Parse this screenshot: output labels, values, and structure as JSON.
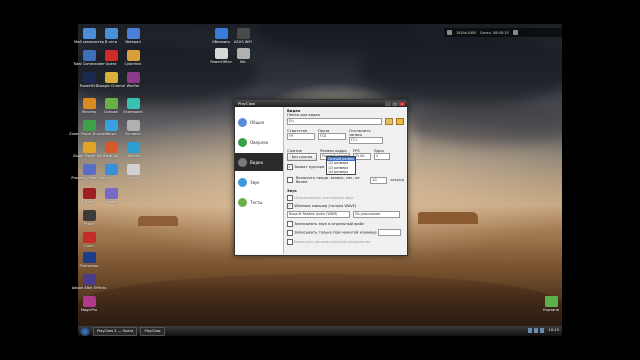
{
  "desktop": {
    "top_bar": {
      "item1": "1920x1080",
      "item2": "Сенск. 08:00:15"
    },
    "icons_left": [
      {
        "label": "Мой компьютер",
        "color": "#4a8fd8"
      },
      {
        "label": "Total Commander",
        "color": "#3f6fb8"
      },
      {
        "label": "PowerDVD",
        "color": "#1c2a52"
      },
      {
        "label": "Winamp",
        "color": "#d98b21"
      },
      {
        "label": "Zoom Player Business",
        "color": "#3fa04a"
      },
      {
        "label": "Zoom Player MAX",
        "color": "#e0a626"
      },
      {
        "label": "Process Video Suite",
        "color": "#5a6ec8"
      },
      {
        "label": "Nero",
        "color": "#9d1f1f"
      },
      {
        "label": "Proxy",
        "color": "#3b3b3b"
      },
      {
        "label": "Corel",
        "color": "#c42b2b"
      },
      {
        "label": "Photoshop",
        "color": "#1b3d8a"
      },
      {
        "label": "Adobe After Effects",
        "color": "#4b3c8a"
      },
      {
        "label": "MagicPro",
        "color": "#b03a8a"
      }
    ],
    "icons_col2": [
      {
        "label": "В сети",
        "color": "#4a8fd8"
      },
      {
        "label": "Opera",
        "color": "#d22a2a"
      },
      {
        "label": "Google Chrome",
        "color": "#d8b03a"
      },
      {
        "label": "Outlook",
        "color": "#6ab04a"
      },
      {
        "label": "Skype",
        "color": "#3aa0e0"
      },
      {
        "label": "FastCall",
        "color": "#d85a2a"
      },
      {
        "label": "ICQ",
        "color": "#3a8fd8"
      },
      {
        "label": "Visual",
        "color": "#7a6ac8"
      }
    ],
    "icons_col3": [
      {
        "label": "Notepad",
        "color": "#4a7fd8"
      },
      {
        "label": "Cyberlink",
        "color": "#d8a03a"
      },
      {
        "label": "WinRar",
        "color": "#8a3a8a"
      },
      {
        "label": "Sharepoint",
        "color": "#3ac0b0"
      },
      {
        "label": "Вставка",
        "color": "#b0b0b0"
      },
      {
        "label": "Utilities",
        "color": "#2aa0d0"
      },
      {
        "label": "Tools",
        "color": "#d0d0d0"
      }
    ],
    "icons_top": [
      {
        "label": "Обновить",
        "color": "#3a7ad8"
      },
      {
        "label": "PowerOffice",
        "color": "#d8d8d8"
      },
      {
        "label": "ASUS WiFi",
        "color": "#4a4a4a"
      },
      {
        "label": "Mic",
        "color": "#b0b0b0"
      }
    ],
    "recycle_label": "Корзина",
    "taskbar": {
      "items": [
        "PlayClaw 5 — Opera",
        "PlayClaw"
      ],
      "clock": "10:15"
    }
  },
  "window": {
    "title": "PlayClaw",
    "controls": {
      "min": "_",
      "max": "□",
      "close": "x"
    },
    "nav": [
      {
        "label": "Общее",
        "icon": "settings-icon",
        "color": "#5a8ad8",
        "active": false
      },
      {
        "label": "Оверлеи",
        "icon": "overlay-icon",
        "color": "#3aa04a",
        "active": false
      },
      {
        "label": "Видео",
        "icon": "video-icon",
        "color": "#7a7a7a",
        "active": true
      },
      {
        "label": "Звук",
        "icon": "sound-icon",
        "color": "#3a9ad8",
        "active": false
      },
      {
        "label": "Тесты",
        "icon": "test-icon",
        "color": "#6ab04a",
        "active": false
      }
    ],
    "video": {
      "section_title": "Видео",
      "folder_label": "Папка для видео",
      "folder_value": "D:\\",
      "fourcc_label": "Стартстоп",
      "fourcc_value": "F9",
      "pause_label": "Пауза",
      "pause_value": "F10",
      "switch_label": "Отключить запись",
      "switch_value": "F11",
      "codec_label": "Сжатие",
      "codec_button": "Без сжатия",
      "size_label": "Размер кадра",
      "size_value": "Полный размер",
      "fps_label": "FPS",
      "fps_value": "25.00",
      "threads_label": "Ядра",
      "threads_value": "4",
      "size_options": [
        "Полный размер",
        "1/2 размера",
        "1/3 размера",
        "1/4 размера"
      ],
      "size_selected": 0,
      "hide_cursor": "Захват курсора",
      "split_label": "Включить предв. запись, сек. не более",
      "split_value": "10",
      "split_unit": "секунд",
      "audio_section": "Звук",
      "audio_opt1": "Записывать звук в отдельный файл",
      "audio_opt2": "Windows микшер (только WAVE)",
      "audio_device": "Вход Ф Realtek Audio (WDM)",
      "audio_format": "По умолчанию",
      "audio_opt3": "Записывать только при нажатой клавише",
      "dis1": "Использовать системный звук",
      "dis2": "Включить автоматическое разделение"
    }
  }
}
